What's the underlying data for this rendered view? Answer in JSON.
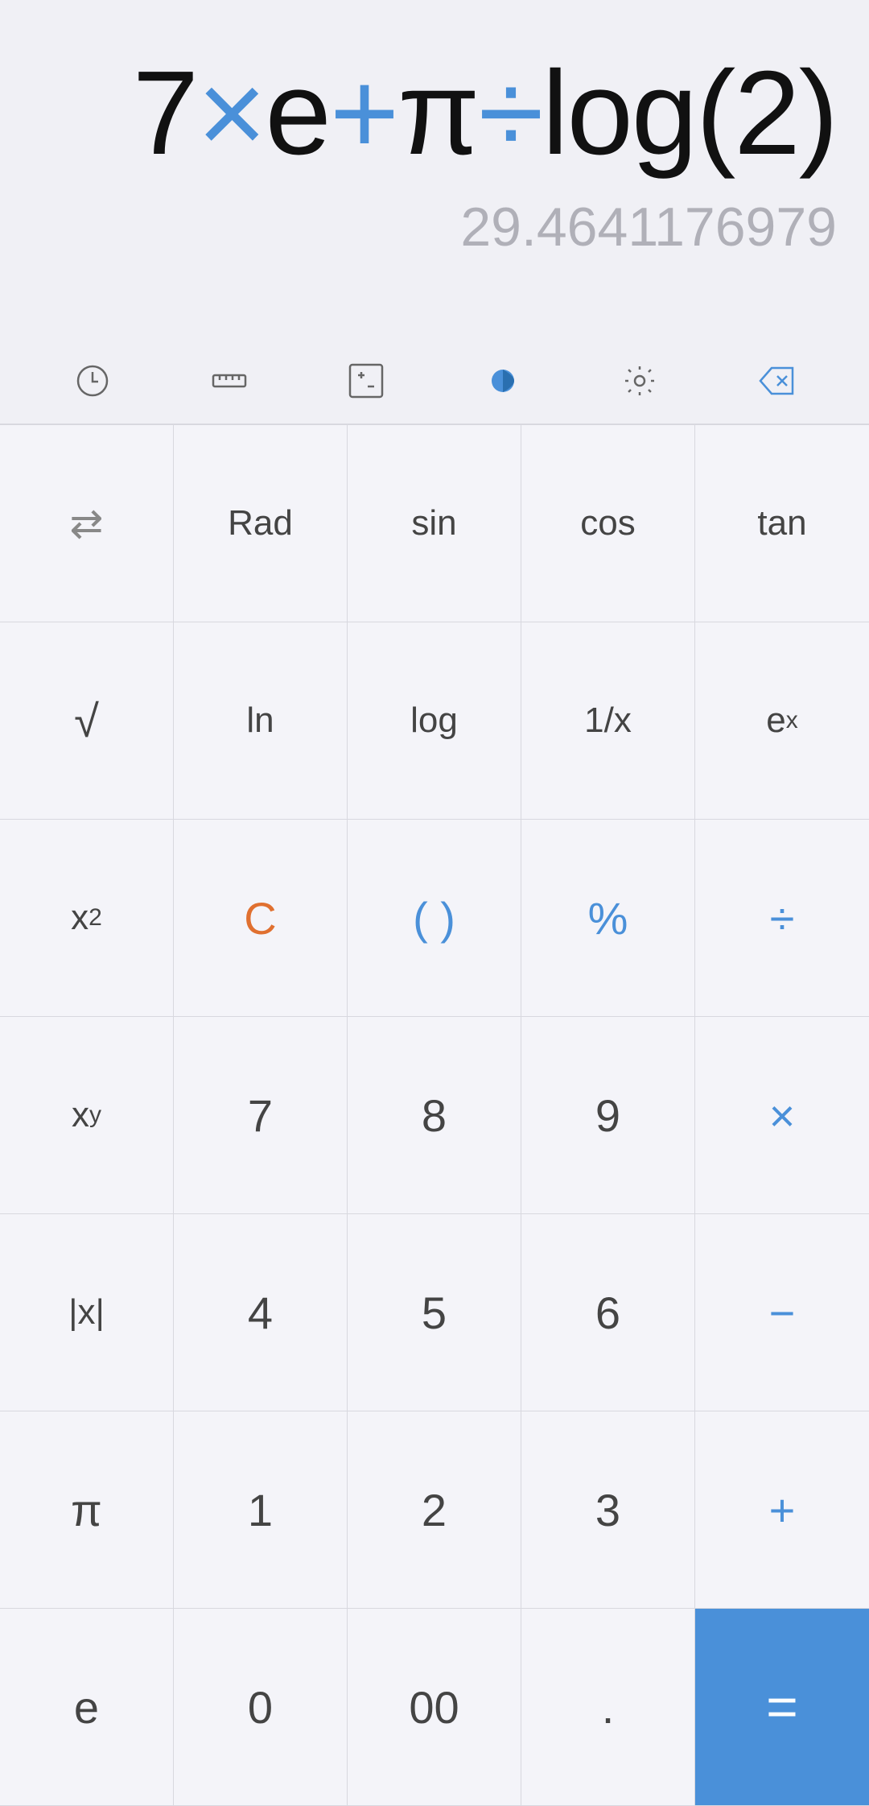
{
  "display": {
    "expression_parts": [
      {
        "text": "7",
        "style": "normal"
      },
      {
        "text": "×",
        "style": "blue"
      },
      {
        "text": "e",
        "style": "normal"
      },
      {
        "text": "+",
        "style": "blue"
      },
      {
        "text": "π",
        "style": "normal"
      },
      {
        "text": "÷",
        "style": "blue"
      },
      {
        "text": "log(2)",
        "style": "normal"
      }
    ],
    "expression_full": "7×e+π÷log(2)",
    "result": "29.4641176979"
  },
  "toolbar": {
    "history_label": "history",
    "ruler_label": "ruler",
    "plusminus_label": "plus-minus",
    "theme_label": "theme",
    "settings_label": "settings",
    "backspace_label": "backspace"
  },
  "keyboard": {
    "rows": [
      [
        {
          "label": "⇄",
          "style": "normal",
          "name": "shift-key"
        },
        {
          "label": "Rad",
          "style": "small-text",
          "name": "rad-key"
        },
        {
          "label": "sin",
          "style": "small-text",
          "name": "sin-key"
        },
        {
          "label": "cos",
          "style": "small-text",
          "name": "cos-key"
        },
        {
          "label": "tan",
          "style": "small-text",
          "name": "tan-key"
        }
      ],
      [
        {
          "label": "√",
          "style": "normal",
          "name": "sqrt-key"
        },
        {
          "label": "ln",
          "style": "small-text",
          "name": "ln-key"
        },
        {
          "label": "log",
          "style": "small-text",
          "name": "log-key"
        },
        {
          "label": "1/x",
          "style": "small-text",
          "name": "reciprocal-key"
        },
        {
          "label": "eˣ",
          "style": "small-text superscript",
          "name": "exp-key"
        }
      ],
      [
        {
          "label": "x²",
          "style": "small-text superscript",
          "name": "square-key"
        },
        {
          "label": "C",
          "style": "orange-text",
          "name": "clear-key"
        },
        {
          "label": "( )",
          "style": "blue-text",
          "name": "parentheses-key"
        },
        {
          "label": "%",
          "style": "blue-text",
          "name": "percent-key"
        },
        {
          "label": "÷",
          "style": "blue-text",
          "name": "divide-key"
        }
      ],
      [
        {
          "label": "xʸ",
          "style": "small-text superscript",
          "name": "power-key"
        },
        {
          "label": "7",
          "style": "normal",
          "name": "seven-key"
        },
        {
          "label": "8",
          "style": "normal",
          "name": "eight-key"
        },
        {
          "label": "9",
          "style": "normal",
          "name": "nine-key"
        },
        {
          "label": "×",
          "style": "blue-text",
          "name": "multiply-key"
        }
      ],
      [
        {
          "label": "|x|",
          "style": "small-text",
          "name": "abs-key"
        },
        {
          "label": "4",
          "style": "normal",
          "name": "four-key"
        },
        {
          "label": "5",
          "style": "normal",
          "name": "five-key"
        },
        {
          "label": "6",
          "style": "normal",
          "name": "six-key"
        },
        {
          "label": "−",
          "style": "blue-text",
          "name": "subtract-key"
        }
      ],
      [
        {
          "label": "π",
          "style": "normal",
          "name": "pi-key"
        },
        {
          "label": "1",
          "style": "normal",
          "name": "one-key"
        },
        {
          "label": "2",
          "style": "normal",
          "name": "two-key"
        },
        {
          "label": "3",
          "style": "normal",
          "name": "three-key"
        },
        {
          "label": "+",
          "style": "blue-text",
          "name": "add-key"
        }
      ],
      [
        {
          "label": "e",
          "style": "normal",
          "name": "euler-key"
        },
        {
          "label": "0",
          "style": "normal",
          "name": "zero-key"
        },
        {
          "label": "00",
          "style": "normal",
          "name": "double-zero-key"
        },
        {
          "label": ".",
          "style": "normal",
          "name": "decimal-key"
        },
        {
          "label": "=",
          "style": "equals",
          "name": "equals-key"
        }
      ]
    ]
  }
}
